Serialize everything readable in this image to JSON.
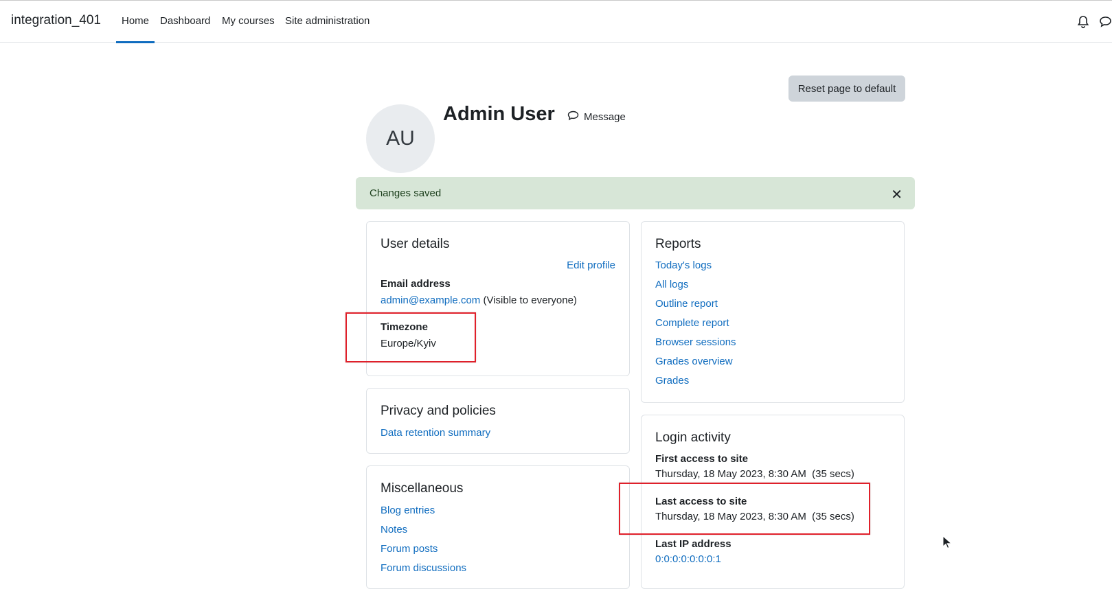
{
  "navbar": {
    "brand": "integration_401",
    "items": [
      {
        "label": "Home",
        "active": true
      },
      {
        "label": "Dashboard"
      },
      {
        "label": "My courses"
      },
      {
        "label": "Site administration"
      }
    ],
    "icons": [
      "bell-icon",
      "chat-bubble-icon"
    ]
  },
  "header": {
    "reset_label": "Reset page to default",
    "avatar_initials": "AU",
    "fullname": "Admin User",
    "message_label": "Message"
  },
  "alert": {
    "text": "Changes saved",
    "close_glyph": "✕"
  },
  "user_details": {
    "title": "User details",
    "edit_profile": "Edit profile",
    "email_label": "Email address",
    "email_value": "admin@example.com",
    "email_visibility": "(Visible to everyone)",
    "timezone_label": "Timezone",
    "timezone_value": "Europe/Kyiv"
  },
  "privacy": {
    "title": "Privacy and policies",
    "link": "Data retention summary"
  },
  "misc": {
    "title": "Miscellaneous",
    "links": [
      "Blog entries",
      "Notes",
      "Forum posts",
      "Forum discussions"
    ]
  },
  "reports": {
    "title": "Reports",
    "links": [
      "Today's logs",
      "All logs",
      "Outline report",
      "Complete report",
      "Browser sessions",
      "Grades overview",
      "Grades"
    ]
  },
  "login_activity": {
    "title": "Login activity",
    "first_access_label": "First access to site",
    "first_access_value": "Thursday, 18 May 2023, 8:30 AM  (35 secs)",
    "last_access_label": "Last access to site",
    "last_access_value": "Thursday, 18 May 2023, 8:30 AM  (35 secs)",
    "last_ip_label": "Last IP address",
    "last_ip_value": "0:0:0:0:0:0:0:1"
  },
  "colors": {
    "link": "#0f6cbf",
    "alert_bg": "#d7e6d7",
    "highlight": "#e0202a"
  }
}
